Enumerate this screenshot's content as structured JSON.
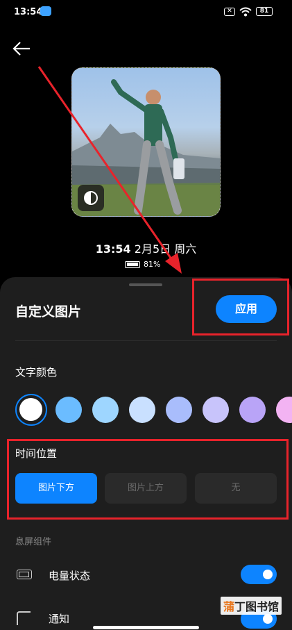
{
  "status_bar": {
    "time": "13:54",
    "battery": "81"
  },
  "preview": {
    "time": "13:54",
    "date": "2月5日 周六",
    "battery_percent": "81%"
  },
  "sheet": {
    "title": "自定义图片",
    "apply_label": "应用",
    "text_color": {
      "label": "文字颜色",
      "selected_index": 0,
      "swatches": [
        "#ffffff",
        "#6bbcff",
        "#9ed6ff",
        "#c9e0ff",
        "#a9bdfc",
        "#c8c4fb",
        "#b9a4f7",
        "#f3b3f3"
      ]
    },
    "time_position": {
      "label": "时间位置",
      "options": [
        "图片下方",
        "图片上方",
        "无"
      ],
      "selected": "图片下方"
    },
    "widgets": {
      "section_label": "息屏组件",
      "battery_label": "电量状态",
      "battery_on": true,
      "notify_label": "通知",
      "notify_on": true
    }
  },
  "watermark": {
    "text_orange": "蒲",
    "text_rest": "丁图书馆"
  },
  "colors": {
    "accent": "#0d84ff",
    "annotation": "#e8232b"
  }
}
